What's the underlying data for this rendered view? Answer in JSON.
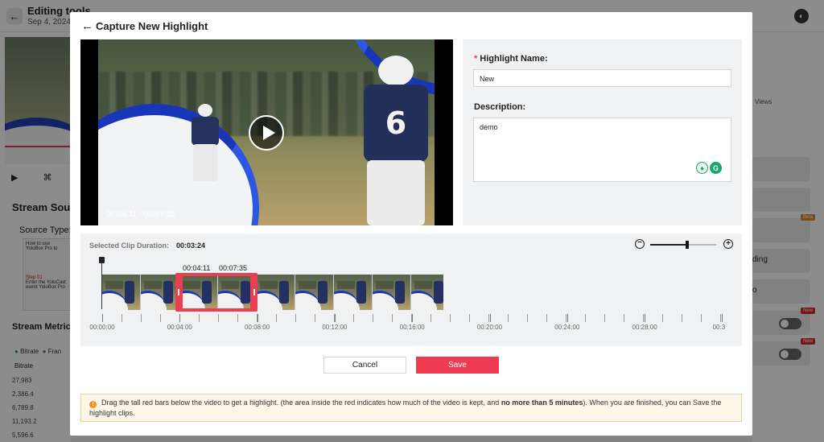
{
  "background": {
    "title": "Editing tools",
    "date": "Sep 4, 2024 0",
    "stream_source": "Stream Sour",
    "source_type": "Source Type:",
    "guide_card": "How to use YoloBox Pro to",
    "step": "Step 01",
    "step_text": "Enter the YoloCast event YoloBox Pro",
    "stream_metrics": "Stream Metrics",
    "legend_bitrate": "Bitrate",
    "legend_frame": "Fran",
    "bitrate_label": "Bitrate",
    "y_values": [
      "27,983",
      "2,386.4",
      "6,789.8",
      "11,193.2",
      "5,596.6"
    ],
    "views": "Views",
    "right_rows": [
      "",
      "",
      "",
      "ding",
      "o",
      "",
      ""
    ],
    "badge_beta": "Beta",
    "badge_new": "New"
  },
  "modal": {
    "title": "Capture New Highlight",
    "player": {
      "time": "00:04:11 / 00:07:35",
      "jersey_number": "6"
    },
    "form": {
      "name_label": "Highlight Name:",
      "name_value": "New",
      "description_label": "Description:",
      "description_value": "demo"
    },
    "timeline": {
      "duration_label": "Selected Clip Duration:",
      "duration_value": "00:03:24",
      "selection_start": "00:04:11",
      "selection_end": "00:07:35",
      "zoom_level": 0.56,
      "ticks": [
        "00:00:00",
        "00:04:00",
        "00:08:00",
        "00:12:00",
        "00:16:00",
        "00:20:00",
        "00:24:00",
        "00:28:00",
        "00:3"
      ]
    },
    "buttons": {
      "cancel": "Cancel",
      "save": "Save"
    },
    "notice": {
      "icon": "!",
      "text_1": "Drag the tall red bars below the video to get a highlight. (the area inside the red indicates how much of the video is kept, and ",
      "text_bold": "no more than 5 minutes",
      "text_2": "). When you are finished, you can Save the highlight clips."
    }
  },
  "colors": {
    "accent": "#ee3b51",
    "notice_bg": "#fdf6e9",
    "warning": "#f0901e",
    "grammarly": "#15a56d"
  }
}
